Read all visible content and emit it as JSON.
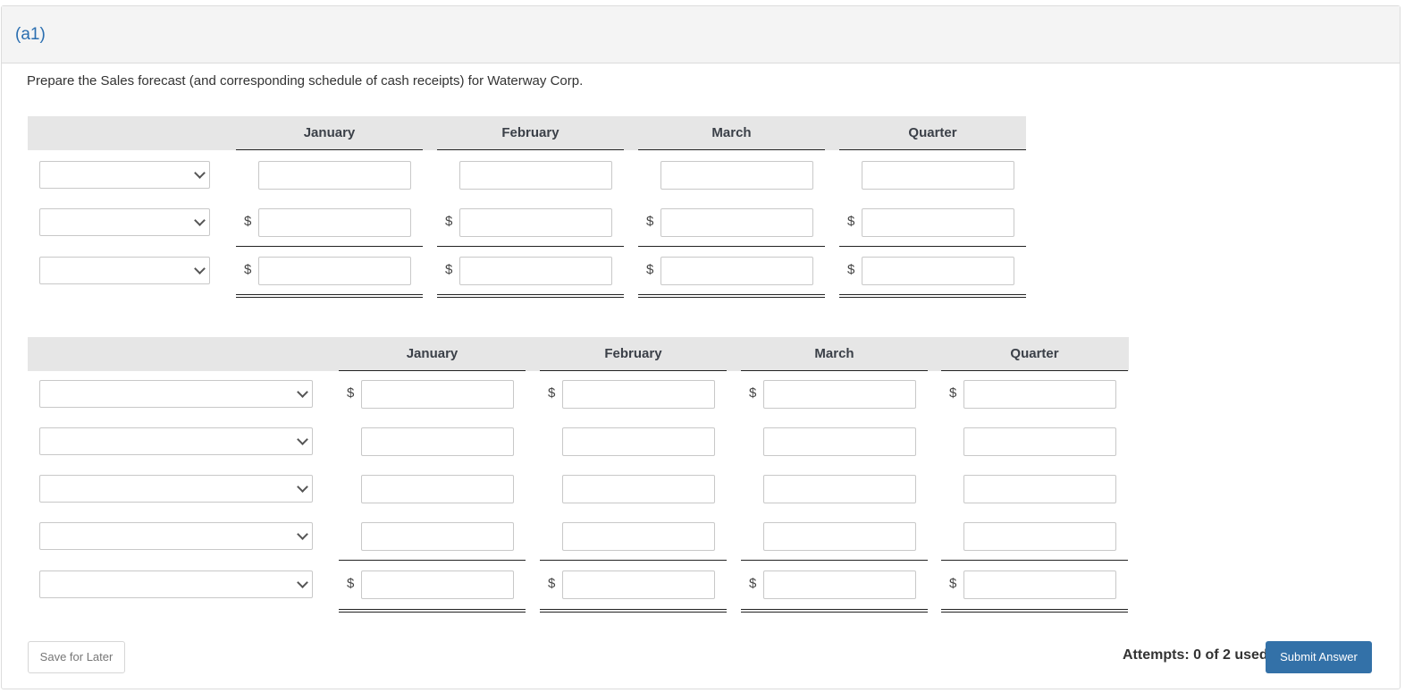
{
  "part_label": "(a1)",
  "prompt": "Prepare the Sales forecast (and corresponding schedule of cash receipts) for Waterway Corp.",
  "columns": [
    "January",
    "February",
    "March",
    "Quarter"
  ],
  "sales_forecast": {
    "rows": [
      {
        "select_value": "",
        "has_dollar": false,
        "values": [
          "",
          "",
          "",
          ""
        ]
      },
      {
        "select_value": "",
        "has_dollar": true,
        "values": [
          "",
          "",
          "",
          ""
        ]
      },
      {
        "select_value": "",
        "has_dollar": true,
        "values": [
          "",
          "",
          "",
          ""
        ]
      }
    ]
  },
  "cash_receipts": {
    "rows": [
      {
        "select_value": "",
        "has_dollar": true,
        "values": [
          "",
          "",
          "",
          ""
        ]
      },
      {
        "select_value": "",
        "has_dollar": false,
        "values": [
          "",
          "",
          "",
          ""
        ]
      },
      {
        "select_value": "",
        "has_dollar": false,
        "values": [
          "",
          "",
          "",
          ""
        ]
      },
      {
        "select_value": "",
        "has_dollar": false,
        "values": [
          "",
          "",
          "",
          ""
        ]
      },
      {
        "select_value": "",
        "has_dollar": true,
        "values": [
          "",
          "",
          "",
          ""
        ]
      }
    ]
  },
  "currency_symbol": "$",
  "footer": {
    "save_label": "Save for Later",
    "attempts_text": "Attempts: 0 of 2 used",
    "submit_label": "Submit Answer"
  },
  "colors": {
    "accent": "#3371a8",
    "part_label": "#2a6eb0"
  }
}
